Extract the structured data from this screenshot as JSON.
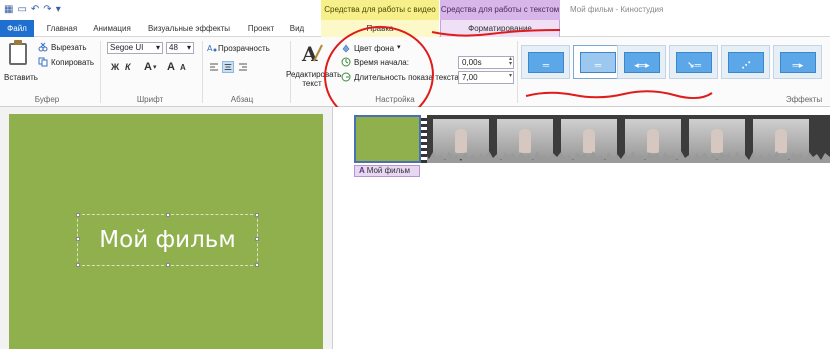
{
  "window": {
    "title": "Мой фильм - Киностудия",
    "context_video": "Средства для работы с видео",
    "context_text": "Средства для работы с текстом"
  },
  "tabs": [
    {
      "label": "Файл"
    },
    {
      "label": "Главная"
    },
    {
      "label": "Анимация"
    },
    {
      "label": "Визуальные эффекты"
    },
    {
      "label": "Проект"
    },
    {
      "label": "Вид"
    },
    {
      "label": "Правка"
    },
    {
      "label": "Форматирование"
    }
  ],
  "ribbon": {
    "clipboard": {
      "paste": "Вставить",
      "cut": "Вырезать",
      "copy": "Копировать",
      "label": "Буфер"
    },
    "font": {
      "family": "Segoe UI",
      "size": "48",
      "bold": "Ж",
      "italic": "К",
      "grow": "A",
      "shrink": "A",
      "label": "Шрифт"
    },
    "paragraph": {
      "transparency": "Прозрачность",
      "label": "Абзац"
    },
    "settings": {
      "edit_text": "Редактировать текст",
      "bg_color": "Цвет фона",
      "start_time": "Время начала:",
      "start_time_value": "0,00s",
      "duration": "Длительность показа текста:",
      "duration_value": "7,00",
      "label": "Настройка"
    },
    "effects": {
      "label": "Эффекты"
    }
  },
  "preview": {
    "text": "Мой фильм"
  },
  "timeline": {
    "title_tag": "Мой фильм"
  },
  "colors": {
    "accent": "#1e6fd0",
    "preview_bg": "#8fb04d",
    "annotation": "#e01b1b",
    "ctx_video": "#f7f08a",
    "ctx_text": "#d9b6ea"
  }
}
